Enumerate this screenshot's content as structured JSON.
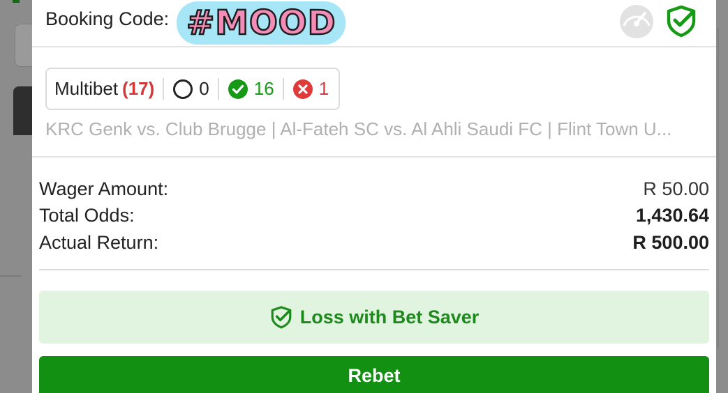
{
  "booking": {
    "label": "Booking Code:",
    "code": "#MOOD"
  },
  "header_icons": [
    "speedometer-icon",
    "shield-check-icon"
  ],
  "bet": {
    "type_label": "Multibet",
    "selection_count": "(17)",
    "pending_count": "0",
    "won_count": "16",
    "lost_count": "1",
    "matches": "KRC Genk vs. Club Brugge | Al-Fateh SC vs. Al Ahli Saudi FC | Flint Town U..."
  },
  "summary": {
    "wager_label": "Wager Amount:",
    "wager_value": "R 50.00",
    "odds_label": "Total Odds:",
    "odds_value": "1,430.64",
    "return_label": "Actual Return:",
    "return_value": "R 500.00"
  },
  "status": {
    "bet_saver_label": "Loss with Bet Saver"
  },
  "actions": {
    "rebet_label": "Rebet"
  },
  "colors": {
    "brand_green": "#119011",
    "won_green": "#169a16",
    "lost_red": "#d03a3a",
    "bet_saver_bg": "#e0f4e0"
  }
}
